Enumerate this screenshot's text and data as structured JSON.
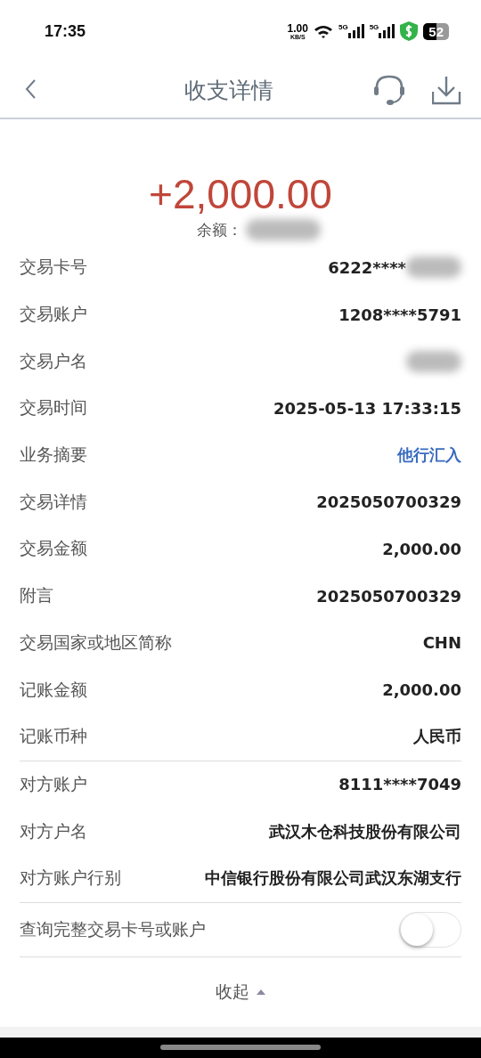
{
  "status_bar": {
    "time": "17:35",
    "net_speed": "1.00",
    "net_unit": "KB/S",
    "signals": [
      {
        "label": "5G"
      },
      {
        "label": "5G"
      }
    ],
    "battery": "52"
  },
  "header": {
    "title": "收支详情"
  },
  "summary": {
    "amount": "+2,000.00",
    "balance_label": "余额：",
    "balance_redacted": true
  },
  "groups": [
    {
      "rows": [
        {
          "label": "交易卡号",
          "value": "6222****",
          "redacted": true
        },
        {
          "label": "交易账户",
          "value": "1208****5791"
        },
        {
          "label": "交易户名",
          "redacted": true
        },
        {
          "label": "交易时间",
          "value": "2025-05-13 17:33:15"
        },
        {
          "label": "业务摘要",
          "value": "他行汇入",
          "kind": "link"
        },
        {
          "label": "交易详情",
          "value": "2025050700329"
        },
        {
          "label": "交易金额",
          "value": "2,000.00"
        },
        {
          "label": "附言",
          "value": "2025050700329"
        },
        {
          "label": "交易国家或地区简称",
          "value": "CHN"
        },
        {
          "label": "记账金额",
          "value": "2,000.00"
        },
        {
          "label": "记账币种",
          "value": "人民币"
        }
      ]
    },
    {
      "rows": [
        {
          "label": "对方账户",
          "value": "8111****7049"
        },
        {
          "label": "对方户名",
          "value": "武汉木仓科技股份有限公司"
        },
        {
          "label": "对方账户行别",
          "value": "中信银行股份有限公司武汉东湖支行"
        }
      ]
    }
  ],
  "toggle": {
    "label": "查询完整交易卡号或账户",
    "on": false
  },
  "collapse": {
    "label": "收起"
  }
}
